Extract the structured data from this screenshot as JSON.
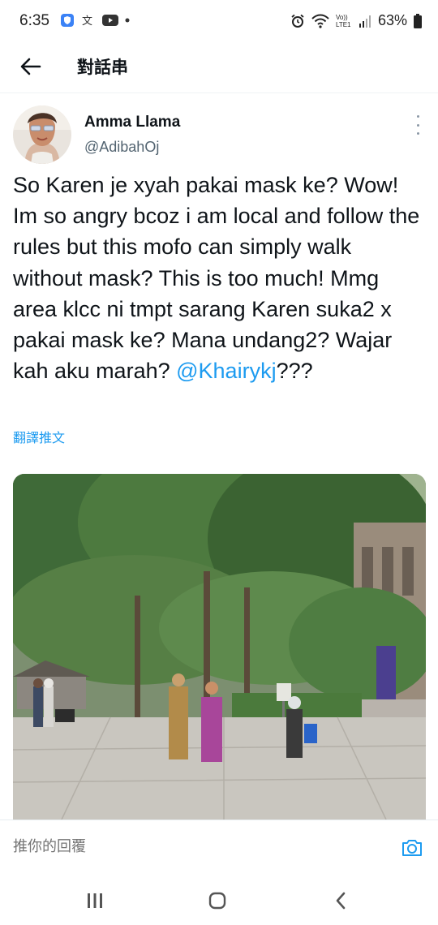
{
  "status_bar": {
    "time": "6:35",
    "network_label": "Vo)) LTE1",
    "battery": "63%",
    "left_icons": [
      "shield-icon",
      "spell-icon",
      "youtube-icon",
      "dot-icon"
    ],
    "right_icons": [
      "alarm-icon",
      "wifi-icon",
      "signal-icon",
      "battery-icon"
    ]
  },
  "header": {
    "back_icon": "arrow-left-icon",
    "title": "對話串"
  },
  "tweet": {
    "author_name": "Amma Llama",
    "author_handle": "@AdibahOj",
    "text": "So Karen je xyah pakai mask ke? Wow! Im so angry bcoz i am local and follow the rules but this mofo can simply walk without mask? This is too much! Mmg area klcc ni tmpt sarang Karen suka2 x pakai mask ke? Mana undang2? Wajar kah aku marah? ",
    "mention": "@Khairykj",
    "text_suffix": "???",
    "translate_label": "翻譯推文"
  },
  "reply": {
    "placeholder": "推你的回覆"
  },
  "colors": {
    "link": "#1d9bf0",
    "text": "#0f1419",
    "secondary": "#536471"
  },
  "nav_icons": [
    "recent-apps-icon",
    "home-icon",
    "back-icon"
  ]
}
